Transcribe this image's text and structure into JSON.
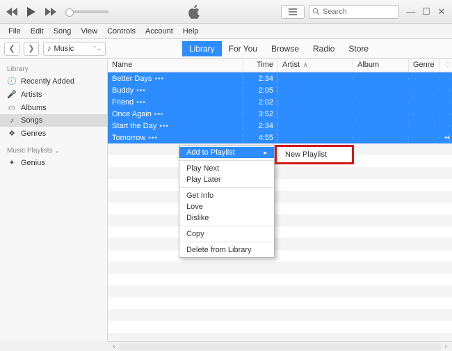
{
  "search": {
    "placeholder": "Search"
  },
  "menus": [
    "File",
    "Edit",
    "Song",
    "View",
    "Controls",
    "Account",
    "Help"
  ],
  "mediaSelect": "Music",
  "tabs": [
    {
      "label": "Library",
      "active": true
    },
    {
      "label": "For You",
      "active": false
    },
    {
      "label": "Browse",
      "active": false
    },
    {
      "label": "Radio",
      "active": false
    },
    {
      "label": "Store",
      "active": false
    }
  ],
  "sidebar": {
    "sections": [
      {
        "header": "Library",
        "items": [
          {
            "label": "Recently Added",
            "iconGlyph": "🕘"
          },
          {
            "label": "Artists",
            "iconGlyph": "🎤"
          },
          {
            "label": "Albums",
            "iconGlyph": "▭"
          },
          {
            "label": "Songs",
            "iconGlyph": "♪",
            "selected": true
          },
          {
            "label": "Genres",
            "iconGlyph": "❖"
          }
        ]
      },
      {
        "header": "Music Playlists",
        "items": [
          {
            "label": "Genius",
            "iconGlyph": "✦"
          }
        ]
      }
    ]
  },
  "columns": {
    "name": "Name",
    "time": "Time",
    "artist": "Artist",
    "album": "Album",
    "genre": "Genre"
  },
  "rows": [
    {
      "name": "Better Days",
      "time": "2:34"
    },
    {
      "name": "Buddy",
      "time": "2:05"
    },
    {
      "name": "Friend",
      "time": "2:02"
    },
    {
      "name": "Once Again",
      "time": "3:52"
    },
    {
      "name": "Start the Day",
      "time": "2:34"
    },
    {
      "name": "Tomorrow",
      "time": "4:55"
    }
  ],
  "contextMenu": {
    "items": [
      {
        "label": "Add to Playlist",
        "hover": true,
        "hasSub": true
      },
      {
        "sep": true
      },
      {
        "label": "Play Next"
      },
      {
        "label": "Play Later"
      },
      {
        "sep": true
      },
      {
        "label": "Get Info"
      },
      {
        "label": "Love"
      },
      {
        "label": "Dislike"
      },
      {
        "sep": true
      },
      {
        "label": "Copy"
      },
      {
        "sep": true
      },
      {
        "label": "Delete from Library"
      }
    ],
    "submenu": {
      "label": "New Playlist"
    }
  }
}
